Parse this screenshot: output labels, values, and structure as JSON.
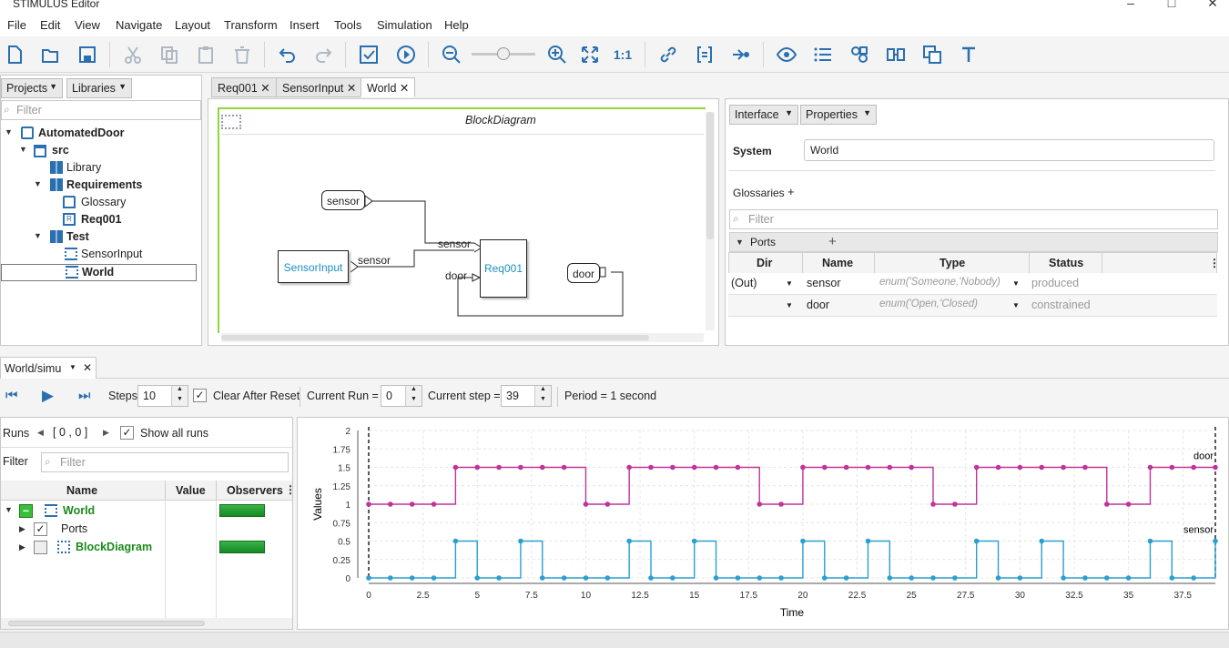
{
  "window": {
    "title": "STIMULUS Editor"
  },
  "menu": [
    "File",
    "Edit",
    "View",
    "Navigate",
    "Layout",
    "Transform",
    "Insert",
    "Tools",
    "Simulation",
    "Help"
  ],
  "toolbar": {
    "zoom_reset_label": "1:1"
  },
  "left_panel": {
    "tabs": [
      "Projects",
      "Libraries"
    ],
    "filter_placeholder": "Filter",
    "tree": [
      {
        "label": "AutomatedDoor",
        "bold": true
      },
      {
        "label": "src",
        "bold": true
      },
      {
        "label": "Library",
        "bold": false
      },
      {
        "label": "Requirements",
        "bold": true
      },
      {
        "label": "Glossary",
        "bold": false
      },
      {
        "label": "Req001",
        "bold": true
      },
      {
        "label": "Test",
        "bold": true
      },
      {
        "label": "SensorInput",
        "bold": false
      },
      {
        "label": "World",
        "bold": true
      }
    ]
  },
  "editor": {
    "tabs": [
      "Req001",
      "SensorInput",
      "World"
    ],
    "diagram_title": "BlockDiagram",
    "blocks": {
      "sensor_in": "SensorInput",
      "req": "Req001",
      "sensor_port": "sensor",
      "door_port": "door"
    },
    "wire_labels": {
      "sensor_out": "sensor",
      "sensor_in": "sensor",
      "door_in": "door"
    }
  },
  "right_panel": {
    "tabs": [
      "Interface",
      "Properties"
    ],
    "system_label": "System",
    "system_value": "World",
    "glossaries_label": "Glossaries",
    "filter_placeholder": "Filter",
    "ports_label": "Ports",
    "columns": [
      "Dir",
      "Name",
      "Type",
      "Status"
    ],
    "rows": [
      {
        "dir": "(Out)",
        "name": "sensor",
        "type": "enum('Someone,'Nobody)",
        "status": "produced"
      },
      {
        "dir": "",
        "name": "door",
        "type": "enum('Open,'Closed)",
        "status": "constrained"
      }
    ]
  },
  "sim": {
    "tab": "World/simu",
    "steps_label": "Steps",
    "steps_value": "10",
    "clear_label": "Clear After Reset",
    "run_label": "Current Run =",
    "run_value": "0",
    "step_label": "Current step =",
    "step_value": "39",
    "period": "Period = 1 second",
    "runs_label": "Runs",
    "runs_range": "[ 0 , 0 ]",
    "show_all": "Show all runs",
    "filter_label": "Filter",
    "filter_placeholder": "Filter",
    "columns": [
      "Name",
      "Value",
      "Observers"
    ],
    "tree": [
      {
        "label": "World"
      },
      {
        "label": "Ports"
      },
      {
        "label": "BlockDiagram"
      }
    ]
  },
  "chart_data": {
    "type": "line",
    "xlabel": "Time",
    "ylabel": "Values",
    "xlim": [
      0,
      39
    ],
    "ylim": [
      0,
      2
    ],
    "xticks": [
      "0",
      "2.5",
      "5",
      "7.5",
      "10",
      "12.5",
      "15",
      "17.5",
      "20",
      "22.5",
      "25",
      "27.5",
      "30",
      "32.5",
      "35",
      "37.5"
    ],
    "yticks": [
      "0",
      "0.25",
      "0.5",
      "0.75",
      "1",
      "1.25",
      "1.5",
      "1.75",
      "2"
    ],
    "x": [
      0,
      1,
      2,
      3,
      4,
      5,
      6,
      7,
      8,
      9,
      10,
      11,
      12,
      13,
      14,
      15,
      16,
      17,
      18,
      19,
      20,
      21,
      22,
      23,
      24,
      25,
      26,
      27,
      28,
      29,
      30,
      31,
      32,
      33,
      34,
      35,
      36,
      37,
      38,
      39
    ],
    "series": [
      {
        "name": "door",
        "color": "#c0339a",
        "values": [
          1,
          1,
          1,
          1,
          1.5,
          1.5,
          1.5,
          1.5,
          1.5,
          1.5,
          1,
          1,
          1.5,
          1.5,
          1.5,
          1.5,
          1.5,
          1.5,
          1,
          1,
          1.5,
          1.5,
          1.5,
          1.5,
          1.5,
          1.5,
          1,
          1,
          1.5,
          1.5,
          1.5,
          1.5,
          1.5,
          1.5,
          1,
          1,
          1.5,
          1.5,
          1.5,
          1.5
        ]
      },
      {
        "name": "sensor",
        "color": "#2a9fd0",
        "values": [
          0,
          0,
          0,
          0,
          0.5,
          0,
          0,
          0.5,
          0,
          0,
          0,
          0,
          0.5,
          0,
          0,
          0.5,
          0,
          0,
          0,
          0,
          0.5,
          0,
          0,
          0.5,
          0,
          0,
          0,
          0,
          0.5,
          0,
          0,
          0.5,
          0,
          0,
          0,
          0,
          0.5,
          0,
          0,
          0.5
        ]
      }
    ]
  }
}
